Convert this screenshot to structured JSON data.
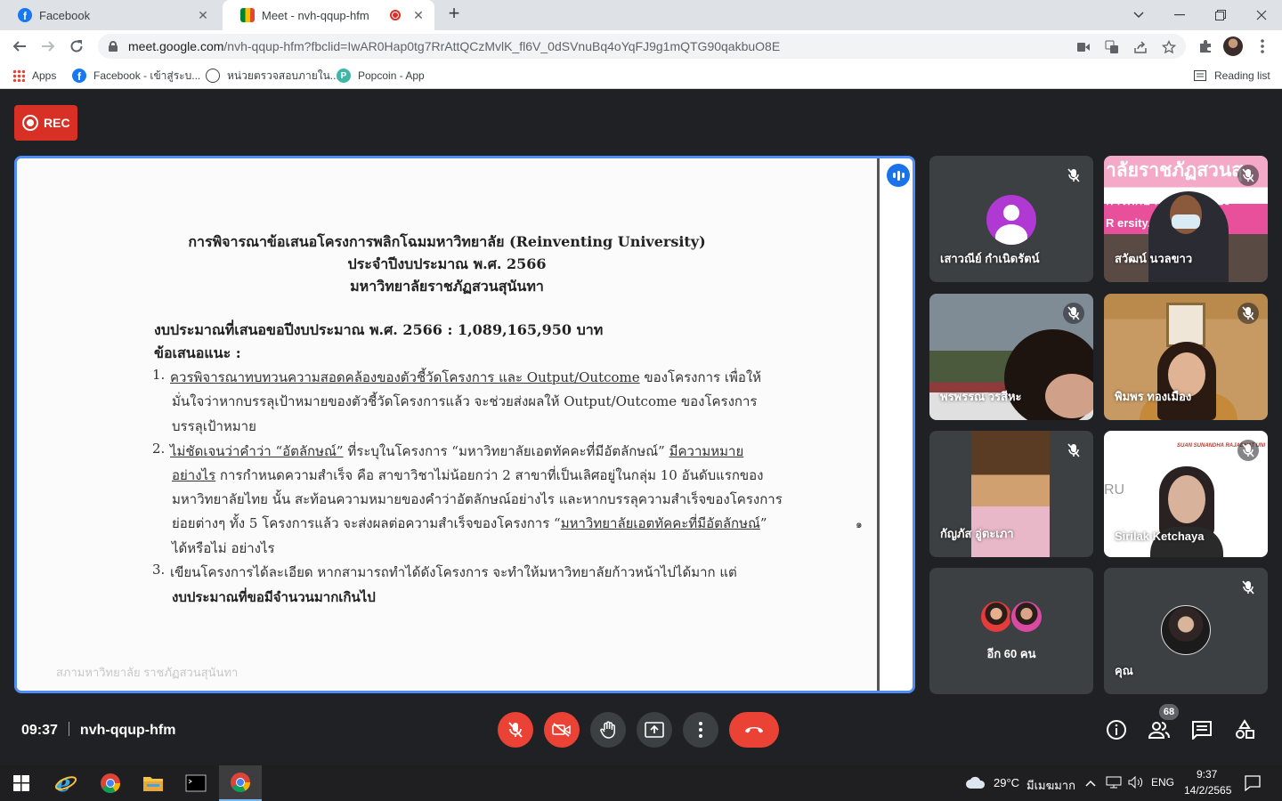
{
  "browser": {
    "tabs": [
      {
        "title": "Facebook",
        "active": false
      },
      {
        "title": "Meet - nvh-qqup-hfm",
        "active": true
      }
    ],
    "url_host": "meet.google.com",
    "url_path": "/nvh-qqup-hfm?fbclid=IwAR0Hap0tg7RrAttQCzMvlK_fl6V_0dSVnuBq4oYqFJ9g1mQTG90qakbuO8E",
    "bookmarks": [
      {
        "label": "Apps",
        "icon": "apps-grid-icon"
      },
      {
        "label": "Facebook - เข้าสู่ระบ...",
        "icon": "facebook-icon"
      },
      {
        "label": "หน่วยตรวจสอบภายใน...",
        "icon": "globe-icon"
      },
      {
        "label": "Popcoin - App",
        "icon": "popcoin-icon"
      }
    ],
    "reading_list": "Reading list"
  },
  "meet": {
    "rec_label": "REC",
    "meeting_time": "09:37",
    "meeting_code": "nvh-qqup-hfm",
    "participant_count": "68",
    "accent_red": "#ea4335",
    "presenting_border": "#4f8ef7"
  },
  "document": {
    "title_lines": [
      "การพิจารณาข้อเสนอโครงการพลิกโฉมมหาวิทยาลัย (Reinventing University)",
      "ประจำปีงบประมาณ พ.ศ. 2566",
      "มหาวิทยาลัยราชภัฏสวนสุนันทา"
    ],
    "budget_line": "งบประมาณที่เสนอขอปีงบประมาณ พ.ศ. 2566 : 1,089,165,950 บาท",
    "suggestions_heading": "ข้อเสนอแนะ :",
    "item1_a_ul": "ควรพิจารณาทบทวนความสอดคล้องของตัวชี้วัดโครงการ และ Output/Outcome",
    "item1_a_rest": " ของโครงการ เพื่อให้",
    "item1_b": "มั่นใจว่าหากบรรลุเป้าหมายของตัวชี้วัดโครงการแล้ว จะช่วยส่งผลให้ Output/Outcome ของโครงการ",
    "item1_c": "บรรลุเป้าหมาย",
    "item2_a_ul": "ไม่ชัดเจนว่าคำว่า “อัตลักษณ์”",
    "item2_a_mid": " ที่ระบุในโครงการ “มหาวิทยาลัยเอตทัคคะที่มีอัตลักษณ์” ",
    "item2_a_ul2": "มีความหมาย",
    "item2_b_ul": "อย่างไร",
    "item2_b_rest": " การกำหนดความสำเร็จ คือ สาขาวิชาไม่น้อยกว่า 2 สาขาที่เป็นเลิศอยู่ในกลุ่ม 10 อันดับแรกของ",
    "item2_c": "มหาวิทยาลัยไทย นั้น สะท้อนความหมายของคำว่าอัตลักษณ์อย่างไร และหากบรรลุความสำเร็จของโครงการ",
    "item2_d_pre": "ย่อยต่างๆ ทั้ง 5 โครงการแล้ว จะส่งผลต่อความสำเร็จของโครงการ “",
    "item2_d_ul": "มหาวิทยาลัยเอตทัคคะที่มีอัตลักษณ์",
    "item2_d_post": "”",
    "item2_e": "ได้หรือไม่ อย่างไร",
    "item3_a": "เขียนโครงการได้ละเอียด หากสามารถทำได้ดังโครงการ จะทำให้มหาวิทยาลัยก้าวหน้าไปได้มาก แต่",
    "item3_b": "งบประมาณที่ขอมีจำนวนมากเกินไป",
    "num1": "1.",
    "num2": "2.",
    "num3": "3.",
    "page_mark": "๑",
    "footer": "สภามหาวิทยาลัย ราชภัฏสวนสุนันทา"
  },
  "participants": [
    {
      "name": "เสาวณีย์ กำเนิดรัตน์",
      "type": "avatar"
    },
    {
      "name": "สวัฒน์ นวลขาว",
      "type": "camera"
    },
    {
      "name": "พรพรรณ วรสีหะ",
      "type": "camera"
    },
    {
      "name": "พิมพร ทองเมือง",
      "type": "camera"
    },
    {
      "name": "กัญภัส อู่ตะเภา",
      "type": "camera"
    },
    {
      "name": "Sirilak Ketchaya",
      "type": "camera"
    },
    {
      "name": "อีก 60 คน",
      "type": "others"
    },
    {
      "name": "คุณ",
      "type": "self"
    }
  ],
  "tile_texts": {
    "cam1_banner1": "าลัยราชภัฏสวนสุ",
    "cam1_banner2": "การศึกษาจังหวัดระนอง",
    "cam1_banner3": "R   ersity, Ranong",
    "cam5_logo": "SUAN SUNANDHA RAJABHAT UNI",
    "cam5_ru": "RU"
  },
  "taskbar": {
    "weather": "29°C",
    "weather_desc": "มีเมฆมาก",
    "lang": "ENG",
    "time": "9:37",
    "date": "14/2/2565"
  }
}
